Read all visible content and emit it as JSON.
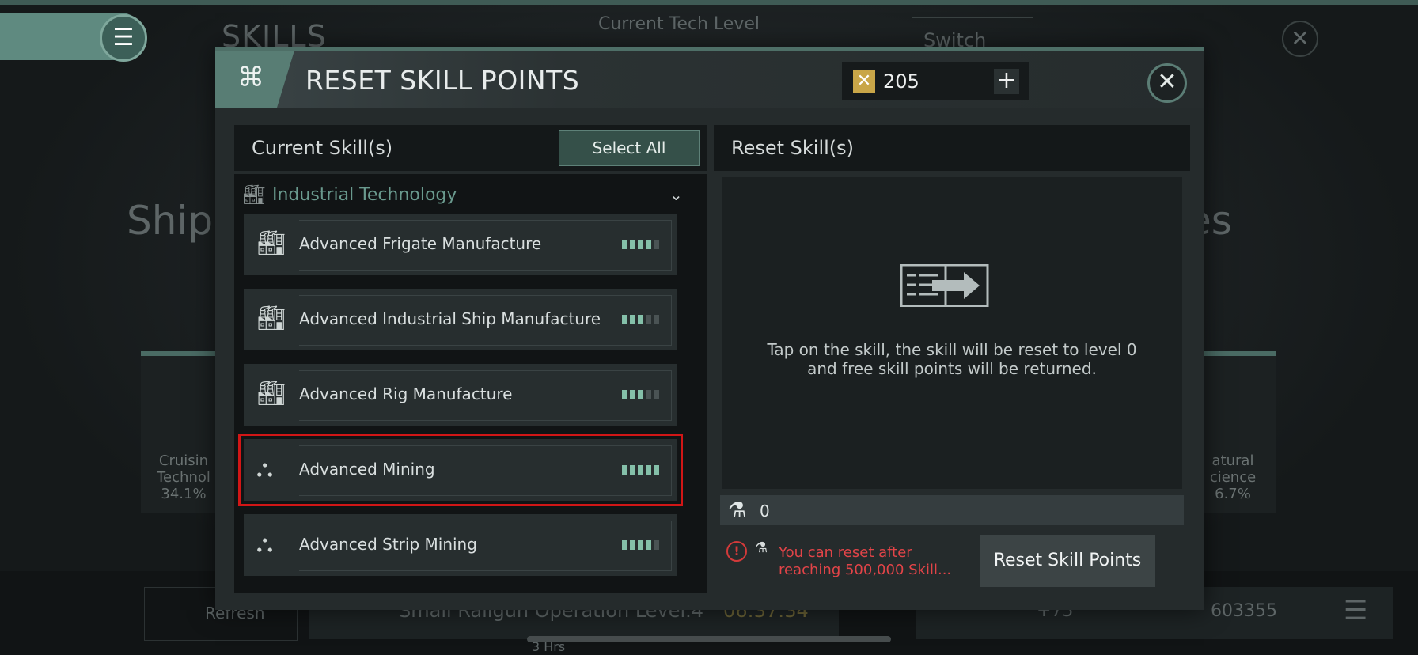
{
  "background": {
    "title": "SKILLS",
    "tech_level_label": "Current Tech Level",
    "switch_label": "Switch",
    "ship_fragment": "Ship",
    "es_fragment": "es",
    "card_left": {
      "label1": "Cruisin",
      "label2": "Technol",
      "percent": "34.1%"
    },
    "card_right": {
      "label1": "atural",
      "label2": "cience",
      "percent": "6.7%"
    },
    "refresh_label": "Refresh",
    "task_label": "Small Railgun Operation Level.4",
    "task_timer": "06:37:34",
    "task_remaining": "3 Hrs",
    "res_bonus": "+75",
    "res_points": "603355"
  },
  "modal": {
    "title": "RESET SKILL POINTS",
    "currency_value": "205",
    "currency_plus": "+",
    "close": "✕"
  },
  "left": {
    "title": "Current Skill(s)",
    "select_all": "Select All",
    "group": {
      "name": "Industrial Technology",
      "icon": "factory-icon"
    },
    "skills": [
      {
        "name": "Advanced Frigate Manufacture",
        "icon": "factory-icon",
        "level": 4,
        "max": 5
      },
      {
        "name": "Advanced Industrial Ship Manufacture",
        "icon": "factory-icon",
        "level": 3,
        "max": 5
      },
      {
        "name": "Advanced Rig Manufacture",
        "icon": "factory-icon",
        "level": 3,
        "max": 5
      },
      {
        "name": "Advanced Mining",
        "icon": "mining-icon",
        "level": 5,
        "max": 5,
        "selected": true
      },
      {
        "name": "Advanced Strip Mining",
        "icon": "mining-icon",
        "level": 4,
        "max": 5
      }
    ]
  },
  "right": {
    "title": "Reset Skill(s)",
    "hint_line1": "Tap on the skill, the skill will be reset to level 0",
    "hint_line2": "and free skill points will be returned.",
    "points_value": "0",
    "warning": "You can reset after reaching 500,000 Skill...",
    "reset_button": "Reset Skill Points"
  },
  "colors": {
    "accent": "#587d74",
    "level_on": "#84c0a9",
    "warning": "#e24448",
    "highlight": "#d11616"
  }
}
